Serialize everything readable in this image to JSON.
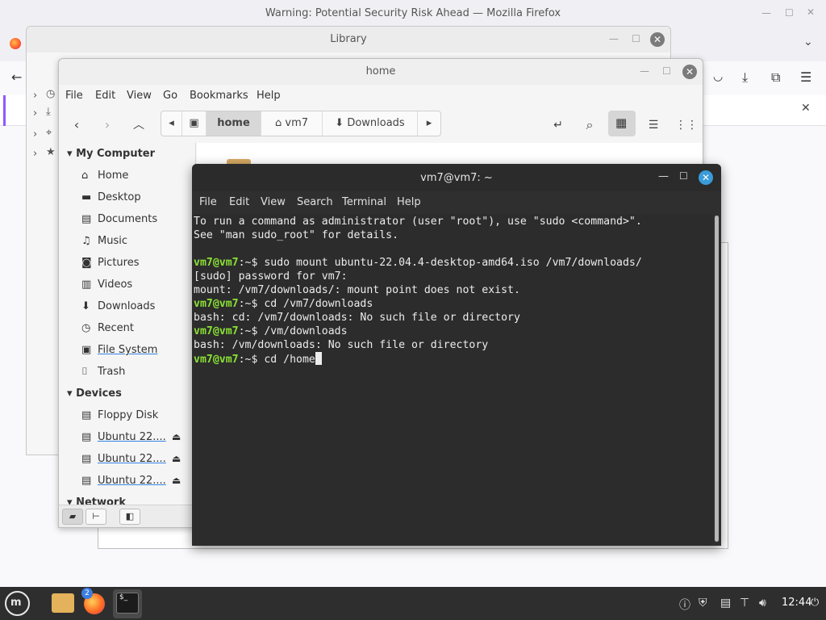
{
  "firefox": {
    "title": "Warning: Potential Security Risk Ahead — Mozilla Firefox"
  },
  "library": {
    "title": "Library"
  },
  "nemo": {
    "title": "home",
    "menu": [
      "File",
      "Edit",
      "View",
      "Go",
      "Bookmarks",
      "Help"
    ],
    "path": [
      "home",
      "vm7",
      "Downloads"
    ],
    "sidebar": {
      "my_computer": "My Computer",
      "places": [
        "Home",
        "Desktop",
        "Documents",
        "Music",
        "Pictures",
        "Videos",
        "Downloads",
        "Recent",
        "File System",
        "Trash"
      ],
      "devices": "Devices",
      "device_items": [
        "Floppy Disk",
        "Ubuntu 22....",
        "Ubuntu 22....",
        "Ubuntu 22...."
      ],
      "network": "Network"
    }
  },
  "terminal": {
    "title": "vm7@vm7: ~",
    "menu": [
      "File",
      "Edit",
      "View",
      "Search",
      "Terminal",
      "Help"
    ],
    "prompt": "vm7@vm7",
    "lines": [
      {
        "text": "To run a command as administrator (user \"root\"), use \"sudo <command>\"."
      },
      {
        "text": "See \"man sudo_root\" for details."
      },
      {
        "text": ""
      },
      {
        "prompt": true,
        "text": ":~$ sudo mount ubuntu-22.04.4-desktop-amd64.iso /vm7/downloads/"
      },
      {
        "text": "[sudo] password for vm7:"
      },
      {
        "text": "mount: /vm7/downloads/: mount point does not exist."
      },
      {
        "prompt": true,
        "text": ":~$ cd /vm7/downloads"
      },
      {
        "text": "bash: cd: /vm7/downloads: No such file or directory"
      },
      {
        "prompt": true,
        "text": ":~$ /vm/downloads"
      },
      {
        "text": "bash: /vm/downloads: No such file or directory"
      },
      {
        "prompt": true,
        "text": ":~$ cd /home",
        "cursor": true
      }
    ]
  },
  "taskbar": {
    "firefox_badge": "2",
    "terminal_glyph": "$_",
    "clock": "12:44"
  }
}
